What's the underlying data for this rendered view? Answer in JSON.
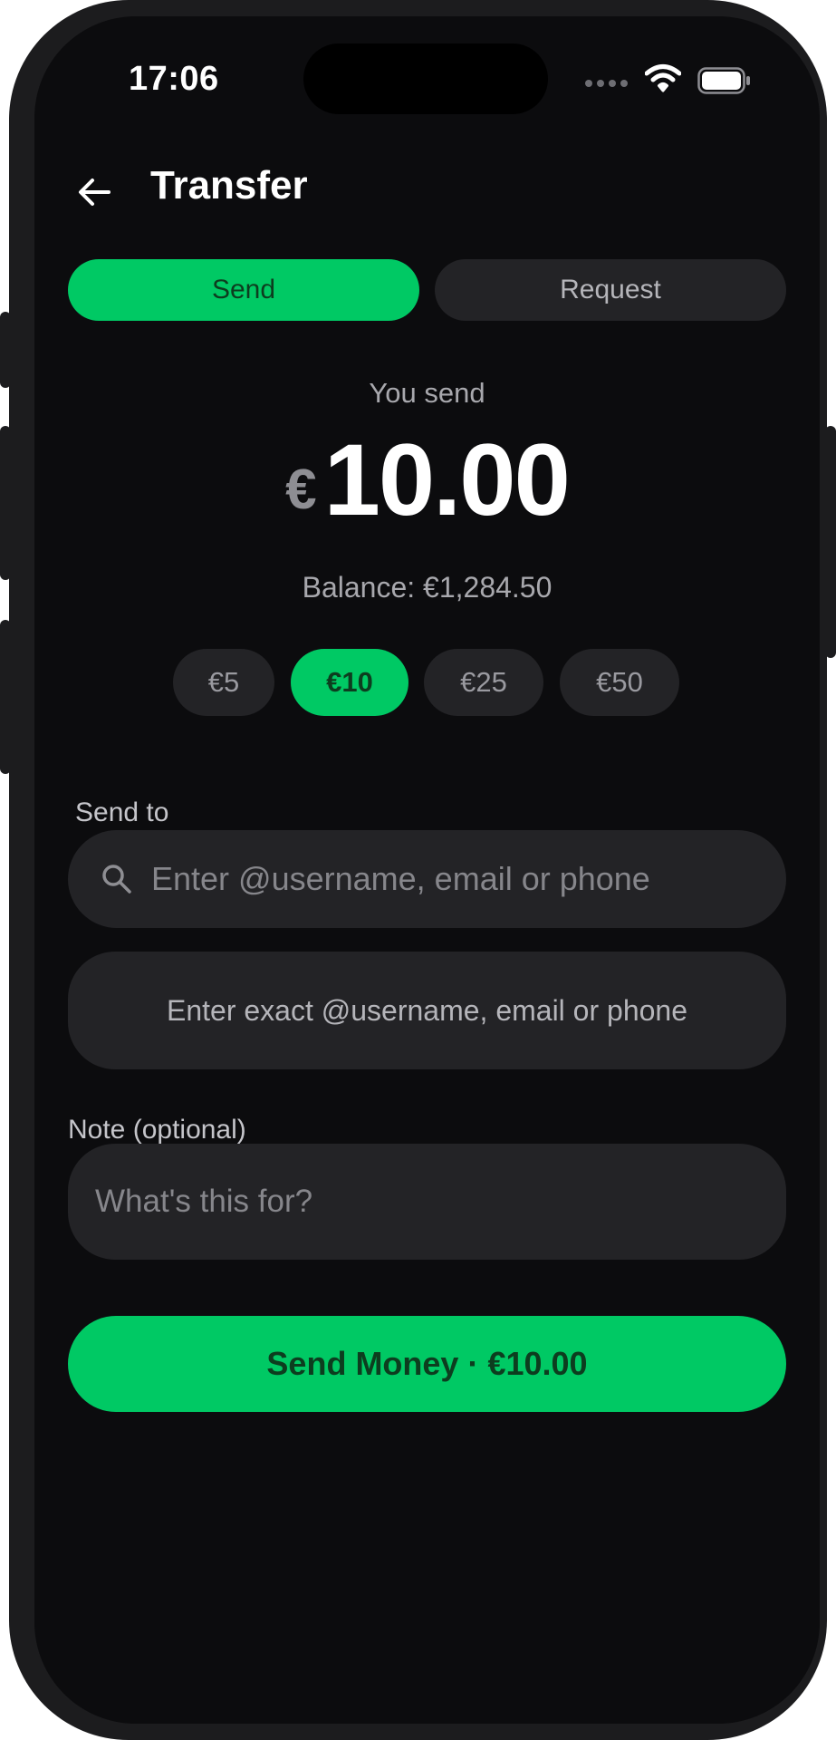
{
  "status_bar": {
    "time": "17:06"
  },
  "header": {
    "title": "Transfer"
  },
  "tabs": [
    {
      "label": "Send",
      "active": true
    },
    {
      "label": "Request",
      "active": false
    }
  ],
  "amount": {
    "caption": "You send",
    "currency_symbol": "€",
    "value": "10.00",
    "balance": "Balance: €1,284.50"
  },
  "quick_amounts": [
    {
      "label": "€5",
      "active": false
    },
    {
      "label": "€10",
      "active": true
    },
    {
      "label": "€25",
      "active": false
    },
    {
      "label": "€50",
      "active": false
    }
  ],
  "recipient": {
    "label": "Send to",
    "search_placeholder": "Enter @username, email or phone",
    "exact_placeholder": "Enter exact @username, email or phone"
  },
  "note": {
    "label": "Note (optional)",
    "placeholder": "What's this for?"
  },
  "submit": {
    "label": "Send Money · €10.00"
  },
  "colors": {
    "accent": "#00c964",
    "background": "#0c0c0e",
    "surface": "#232326"
  }
}
